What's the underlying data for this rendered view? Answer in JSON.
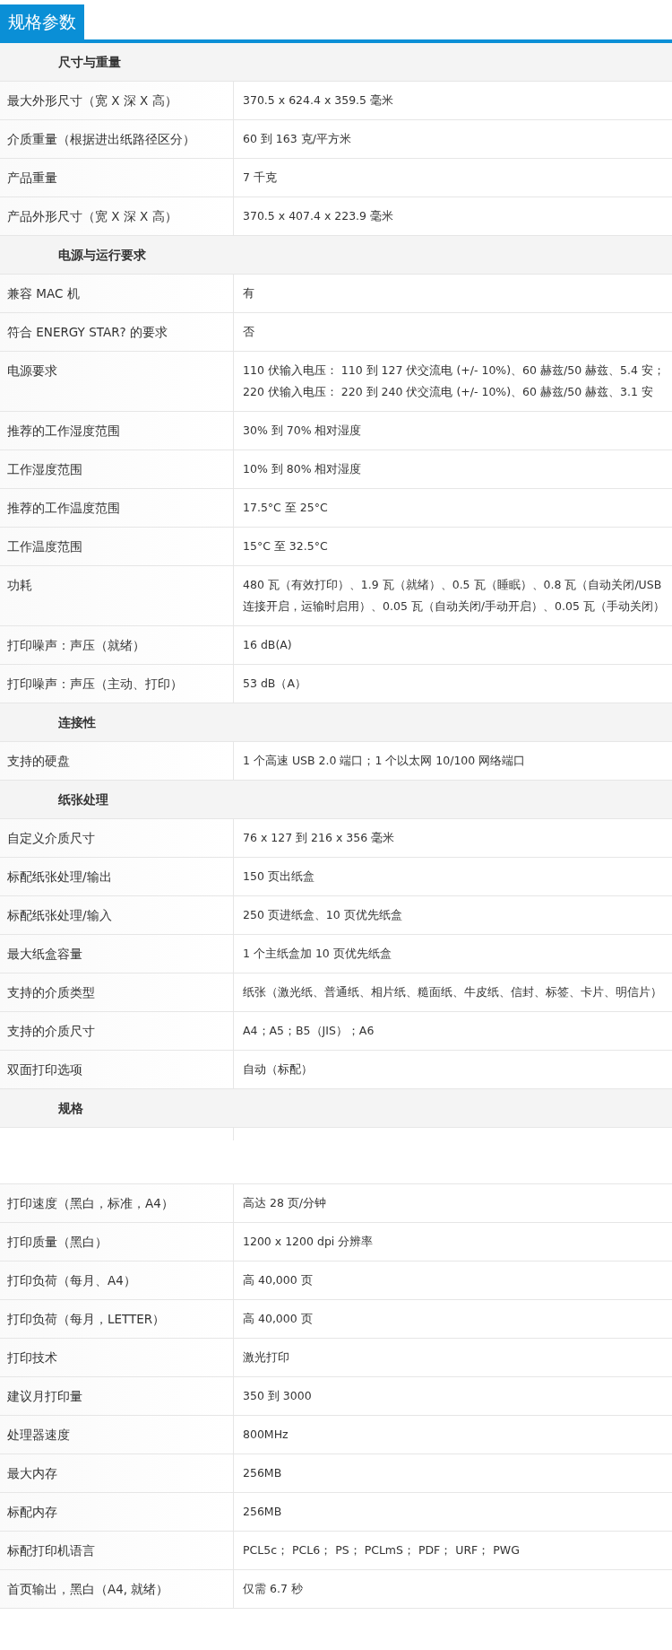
{
  "title": "规格参数",
  "sections": [
    {
      "title": "尺寸与重量",
      "rows": [
        {
          "label": "最大外形尺寸（宽 X 深 X 高）",
          "value": "370.5 x 624.4 x 359.5 毫米"
        },
        {
          "label": "介质重量（根据进出纸路径区分）",
          "value": "60 到 163 克/平方米"
        },
        {
          "label": "产品重量",
          "value": "7 千克"
        },
        {
          "label": "产品外形尺寸（宽 X 深 X 高）",
          "value": "370.5 x 407.4 x 223.9 毫米"
        }
      ]
    },
    {
      "title": "电源与运行要求",
      "rows": [
        {
          "label": "兼容 MAC 机",
          "value": "有"
        },
        {
          "label": "符合 ENERGY STAR? 的要求",
          "value": "否"
        },
        {
          "label": "电源要求",
          "value": "110 伏输入电压： 110 到 127 伏交流电 (+/- 10%)、60 赫兹/50 赫兹、5.4 安； 220 伏输入电压： 220 到 240 伏交流电 (+/- 10%)、60 赫兹/50 赫兹、3.1 安"
        },
        {
          "label": "推荐的工作湿度范围",
          "value": "30% 到 70% 相对湿度"
        },
        {
          "label": "工作湿度范围",
          "value": "10% 到 80% 相对湿度"
        },
        {
          "label": "推荐的工作温度范围",
          "value": "17.5°C 至 25°C"
        },
        {
          "label": "工作温度范围",
          "value": "15°C 至 32.5°C"
        },
        {
          "label": "功耗",
          "value": "480 瓦（有效打印）、1.9 瓦（就绪）、0.5 瓦（睡眠）、0.8 瓦（自动关闭/USB 连接开启，运输时启用）、0.05 瓦（自动关闭/手动开启）、0.05 瓦（手动关闭）"
        },
        {
          "label": "打印噪声：声压（就绪）",
          "value": "16 dB(A)"
        },
        {
          "label": "打印噪声：声压（主动、打印）",
          "value": "53 dB（A）"
        }
      ]
    },
    {
      "title": "连接性",
      "rows": [
        {
          "label": "支持的硬盘",
          "value": "1 个高速 USB 2.0 端口；1 个以太网 10/100 网络端口"
        }
      ]
    },
    {
      "title": "纸张处理",
      "rows": [
        {
          "label": "自定义介质尺寸",
          "value": "76 x 127 到 216 x 356 毫米"
        },
        {
          "label": "标配纸张处理/输出",
          "value": "150 页出纸盒"
        },
        {
          "label": "标配纸张处理/输入",
          "value": "250 页进纸盒、10 页优先纸盒"
        },
        {
          "label": "最大纸盒容量",
          "value": "1 个主纸盒加 10 页优先纸盒"
        },
        {
          "label": "支持的介质类型",
          "value": "纸张（激光纸、普通纸、相片纸、糙面纸、牛皮纸、信封、标签、卡片、明信片）"
        },
        {
          "label": "支持的介质尺寸",
          "value": "A4；A5；B5（JIS）；A6"
        },
        {
          "label": "双面打印选项",
          "value": "自动（标配）"
        }
      ]
    },
    {
      "title": "规格",
      "rows": [
        {
          "label": "打印速度（黑白，标准，A4）",
          "value": "高达 28 页/分钟"
        },
        {
          "label": "打印质量（黑白）",
          "value": "1200 x 1200 dpi 分辨率"
        },
        {
          "label": "打印负荷（每月、A4）",
          "value": "高 40,000 页"
        },
        {
          "label": "打印负荷（每月，LETTER）",
          "value": "高 40,000 页"
        },
        {
          "label": "打印技术",
          "value": "激光打印"
        },
        {
          "label": "建议月打印量",
          "value": "350 到 3000"
        },
        {
          "label": "处理器速度",
          "value": "800MHz"
        },
        {
          "label": "最大内存",
          "value": "256MB"
        },
        {
          "label": "标配内存",
          "value": "256MB"
        },
        {
          "label": "标配打印机语言",
          "value": "PCL5c； PCL6； PS； PCLmS； PDF； URF； PWG"
        },
        {
          "label": "首页输出，黑白（A4, 就绪）",
          "value": "仅需 6.7 秒"
        }
      ]
    }
  ]
}
